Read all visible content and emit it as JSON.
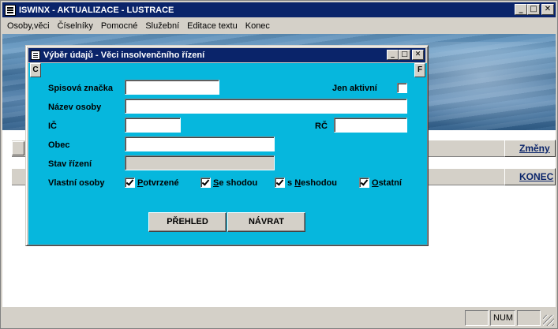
{
  "app": {
    "title": "ISWINX - AKTUALIZACE - LUSTRACE"
  },
  "menu": {
    "items": [
      {
        "label": "Osoby,věci",
        "name": "menu-osoby-veci"
      },
      {
        "label": "Číselníky",
        "name": "menu-ciselniky"
      },
      {
        "label": "Pomocné",
        "name": "menu-pomocne"
      },
      {
        "label": "Služební",
        "name": "menu-sluzebni"
      },
      {
        "label": "Editace textu",
        "name": "menu-editace-textu"
      },
      {
        "label": "Konec",
        "name": "menu-konec"
      }
    ]
  },
  "side_buttons": {
    "zmeny": "Změny",
    "konec": "KONEC"
  },
  "status_bar": {
    "cell1": "",
    "cell2": "NUM",
    "cell3": ""
  },
  "dialog": {
    "title": "Výběr údajů - Věci insolvenčního řízení",
    "corner_left": "C",
    "corner_right": "F",
    "fields": {
      "spisova_znacka": {
        "label": "Spisová značka",
        "value": ""
      },
      "jen_aktivni": {
        "label": "Jen aktivní",
        "checked": false
      },
      "nazev_osoby": {
        "label": "Název osoby",
        "value": ""
      },
      "ic": {
        "label": "IČ",
        "value": ""
      },
      "rc": {
        "label": "RČ",
        "value": ""
      },
      "obec": {
        "label": "Obec",
        "value": ""
      },
      "stav_rizeni": {
        "label": "Stav řízení",
        "value": ""
      }
    },
    "vlastni_osoby": {
      "label": "Vlastní osoby",
      "options": [
        {
          "prefix": "",
          "underline": "P",
          "rest": "otvrzené",
          "checked": true
        },
        {
          "prefix": "",
          "underline": "S",
          "rest": "e shodou",
          "checked": true
        },
        {
          "prefix": "s ",
          "underline": "N",
          "rest": "eshodou",
          "checked": true
        },
        {
          "prefix": "",
          "underline": "O",
          "rest": "statní",
          "checked": true
        }
      ]
    },
    "buttons": {
      "prehled": "PŘEHLED",
      "navrat": "NÁVRAT"
    }
  }
}
